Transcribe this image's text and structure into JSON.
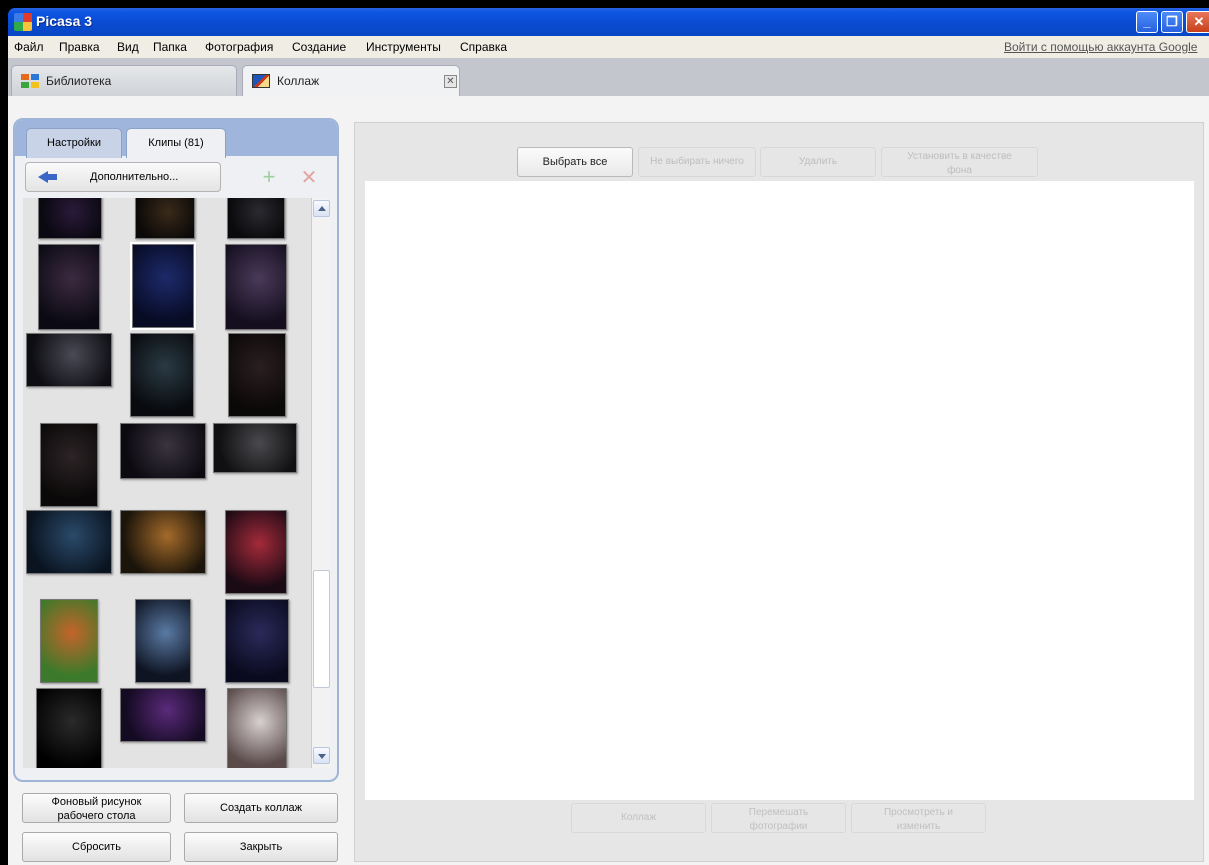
{
  "window": {
    "title": "Picasa 3"
  },
  "menu": {
    "items": [
      "Файл",
      "Правка",
      "Вид",
      "Папка",
      "Фотография",
      "Создание",
      "Инструменты",
      "Справка"
    ],
    "signin": "Войти с помощью аккаунта Google"
  },
  "tabs": {
    "library": "Библиотека",
    "collage": "Коллаж"
  },
  "panel": {
    "tab_settings": "Настройки",
    "tab_clips": "Клипы (81)",
    "more_button": "Дополнительно...",
    "add_icon": "+",
    "remove_icon": "✕"
  },
  "left_buttons": {
    "wallpaper_line1": "Фоновый рисунок",
    "wallpaper_line2": "рабочего стола",
    "create_collage": "Создать коллаж",
    "reset": "Сбросить",
    "close": "Закрыть"
  },
  "toolbar": {
    "select_all": "Выбрать все",
    "select_none": "Не выбирать ничего",
    "delete": "Удалить",
    "set_bg_line1": "Установить в качестве",
    "set_bg_line2": "фона"
  },
  "bottom_toolbar": {
    "collage": "Коллаж",
    "shuffle_line1": "Перемешать",
    "shuffle_line2": "фотографии",
    "view_line1": "Просмотреть и",
    "view_line2": "изменить"
  },
  "clips": [
    {
      "c1": "#2a1a3a",
      "c2": "#0a0810"
    },
    {
      "c1": "#3a2a1a",
      "c2": "#0c0a08"
    },
    {
      "c1": "#2a2a30",
      "c2": "#0a0a0c"
    },
    {
      "c1": "#3c2a40",
      "c2": "#0b0a14"
    },
    {
      "c1": "#1d2a6a",
      "c2": "#070b24",
      "selected": true
    },
    {
      "c1": "#4a3a5a",
      "c2": "#140e1e"
    },
    {
      "c1": "#4a4a56",
      "c2": "#0d0d12"
    },
    {
      "c1": "#2a3a44",
      "c2": "#080a0e"
    },
    {
      "c1": "#2a1e20",
      "c2": "#0b0808"
    },
    {
      "c1": "#2c2426",
      "c2": "#0a0808"
    },
    {
      "c1": "#3a3440",
      "c2": "#0c0a10"
    },
    {
      "c1": "#4a4a4e",
      "c2": "#101012"
    },
    {
      "c1": "#2a4a6a",
      "c2": "#0a1420"
    },
    {
      "c1": "#a46a2a",
      "c2": "#1a140a"
    },
    {
      "c1": "#a42a3a",
      "c2": "#1a0a14"
    },
    {
      "c1": "#c4642a",
      "c2": "#3a7a2a"
    },
    {
      "c1": "#5a7aa4",
      "c2": "#0e1422"
    },
    {
      "c1": "#2a2a5a",
      "c2": "#0a0a1e"
    },
    {
      "c1": "#2a2a2a",
      "c2": "#000000"
    },
    {
      "c1": "#5a2a7a",
      "c2": "#140a22"
    },
    {
      "c1": "#d8d0d0",
      "c2": "#5a4a4a"
    }
  ]
}
